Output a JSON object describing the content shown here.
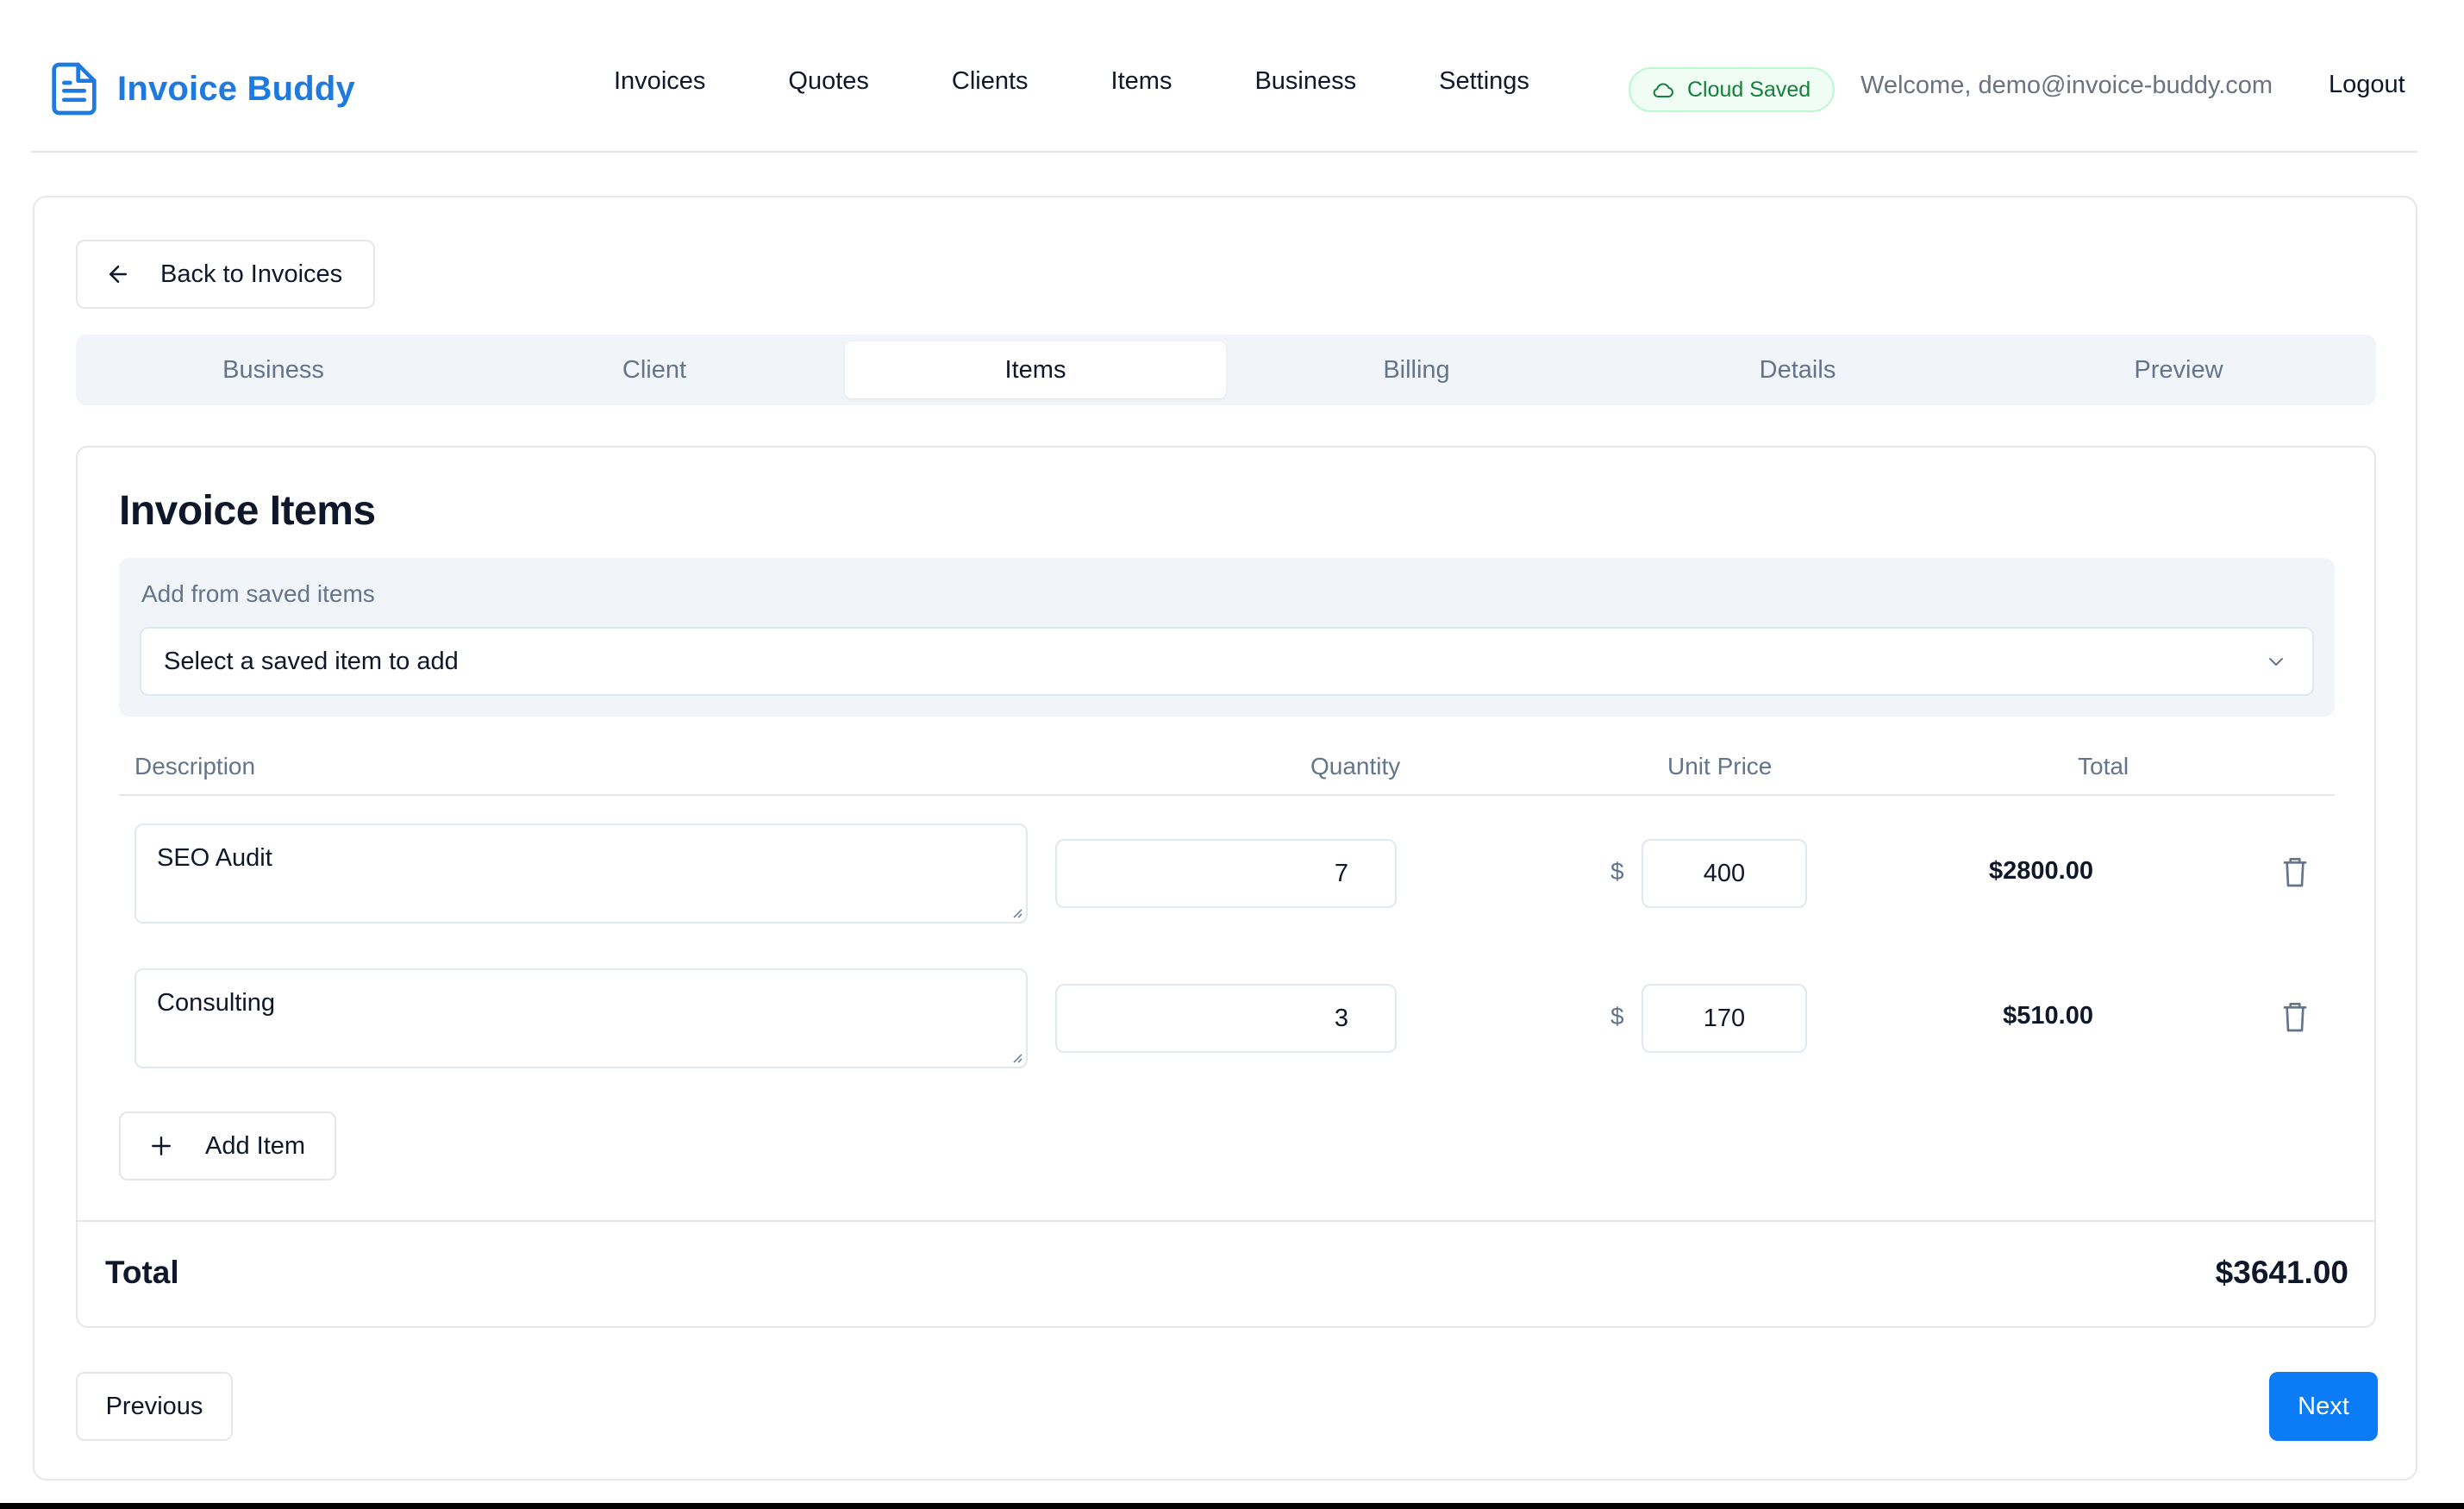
{
  "app": {
    "name": "Invoice Buddy",
    "brand_color": "#1f7ae0",
    "logo_icon": "file-text-icon"
  },
  "nav": {
    "items": [
      {
        "label": "Invoices"
      },
      {
        "label": "Quotes"
      },
      {
        "label": "Clients"
      },
      {
        "label": "Items"
      },
      {
        "label": "Business"
      },
      {
        "label": "Settings"
      }
    ]
  },
  "status": {
    "label": "Cloud Saved",
    "icon": "cloud-icon",
    "color": "#15803d"
  },
  "user": {
    "welcome": "Welcome, demo@invoice-buddy.com",
    "logout": "Logout"
  },
  "back_button": {
    "label": "Back to Invoices",
    "icon": "arrow-left-icon"
  },
  "steps": {
    "tabs": [
      {
        "label": "Business"
      },
      {
        "label": "Client"
      },
      {
        "label": "Items"
      },
      {
        "label": "Billing"
      },
      {
        "label": "Details"
      },
      {
        "label": "Preview"
      }
    ],
    "active": "Items"
  },
  "items_section": {
    "title": "Invoice Items",
    "saved_label": "Add from saved items",
    "saved_select": "Select a saved item to add",
    "columns": {
      "description": "Description",
      "quantity": "Quantity",
      "unit_price": "Unit Price",
      "total": "Total"
    },
    "currency_symbol": "$",
    "rows": [
      {
        "description": "SEO Audit",
        "quantity": "7",
        "unit_price": "400",
        "total": "$2800.00"
      },
      {
        "description": "Consulting",
        "quantity": "3",
        "unit_price": "170",
        "total": "$510.00"
      }
    ],
    "add_item": "Add Item",
    "total_label": "Total",
    "total_value": "$3641.00"
  },
  "footer": {
    "previous": "Previous",
    "next": "Next",
    "next_color": "#0b7cf5"
  }
}
